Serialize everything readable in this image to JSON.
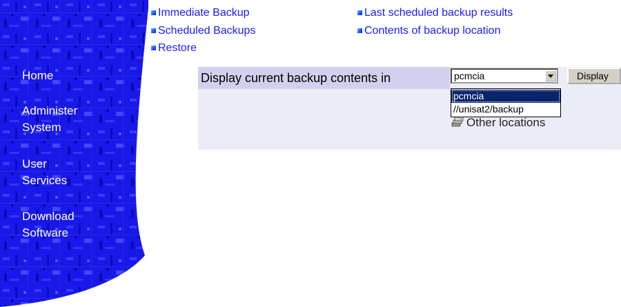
{
  "sidebar": {
    "items": [
      {
        "label": "Home"
      },
      {
        "label": "Administer\nSystem"
      },
      {
        "label": "User\nServices"
      },
      {
        "label": "Download\nSoftware"
      }
    ]
  },
  "links": {
    "left": [
      {
        "label": "Immediate Backup"
      },
      {
        "label": "Scheduled Backups"
      },
      {
        "label": "Restore"
      }
    ],
    "right": [
      {
        "label": "Last scheduled backup results"
      },
      {
        "label": "Contents of backup location"
      }
    ]
  },
  "backup_panel": {
    "label": "Display current backup contents in",
    "select": {
      "value": "pcmcia",
      "options": [
        "pcmcia",
        "//unisat2/backup"
      ]
    },
    "display_button": "Display",
    "other_locations": "Other locations",
    "dash": "-"
  },
  "colors": {
    "sidebar_blue": "#1414e6",
    "link_blue": "#1a1aff",
    "panel_bg": "#ececf6",
    "label_bg": "#d1d1ef",
    "selected_option": "#0a246a"
  }
}
